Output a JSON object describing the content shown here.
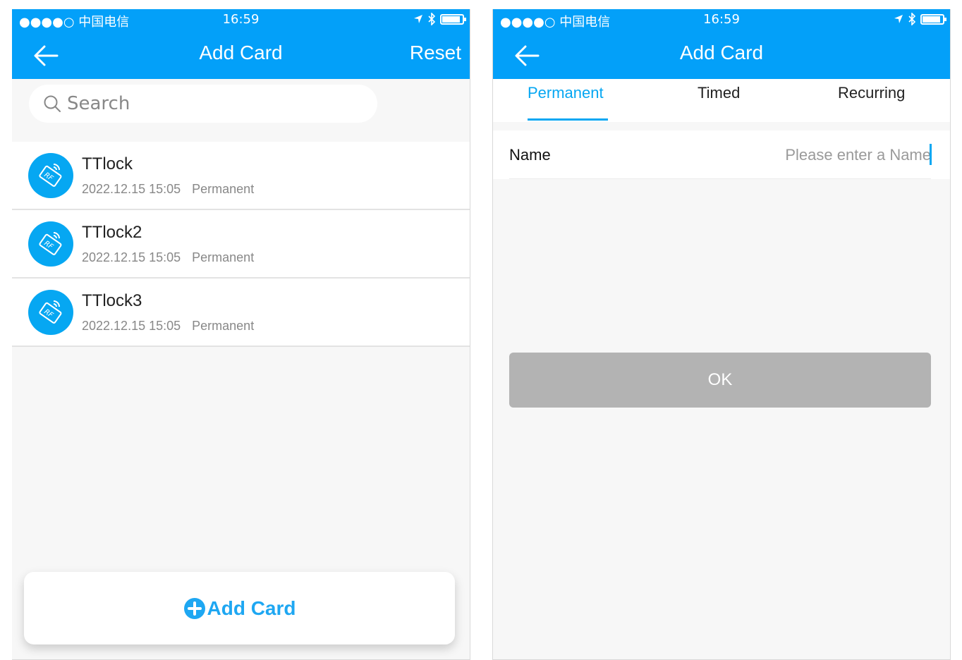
{
  "colors": {
    "brand": "#03a0f9",
    "accent": "#06a7f2",
    "disabled": "#b3b3b3",
    "background": "#f7f7f7"
  },
  "left_screen": {
    "status_bar": {
      "carrier": "●●●●○ 中国电信",
      "time": "16:59"
    },
    "nav": {
      "title": "Add Card",
      "reset_label": "Reset",
      "back_icon": "arrow-left-icon"
    },
    "search": {
      "placeholder": "Search",
      "icon": "search-icon"
    },
    "cards": [
      {
        "name": "TTlock",
        "date": "2022.12.15 15:05",
        "type": "Permanent",
        "icon": "rf-card-icon"
      },
      {
        "name": "TTlock2",
        "date": "2022.12.15 15:05",
        "type": "Permanent",
        "icon": "rf-card-icon"
      },
      {
        "name": "TTlock3",
        "date": "2022.12.15 15:05",
        "type": "Permanent",
        "icon": "rf-card-icon"
      }
    ],
    "add_button": {
      "label": "Add Card",
      "icon": "plus-circle-icon"
    }
  },
  "right_screen": {
    "status_bar": {
      "carrier": "●●●●○ 中国电信",
      "time": "16:59"
    },
    "nav": {
      "title": "Add Card",
      "back_icon": "arrow-left-icon"
    },
    "tabs": [
      {
        "label": "Permanent",
        "active": true
      },
      {
        "label": "Timed",
        "active": false
      },
      {
        "label": "Recurring",
        "active": false
      }
    ],
    "form": {
      "name_label": "Name",
      "name_placeholder": "Please enter a Name",
      "name_value": ""
    },
    "ok_button": {
      "label": "OK",
      "enabled": false
    }
  }
}
